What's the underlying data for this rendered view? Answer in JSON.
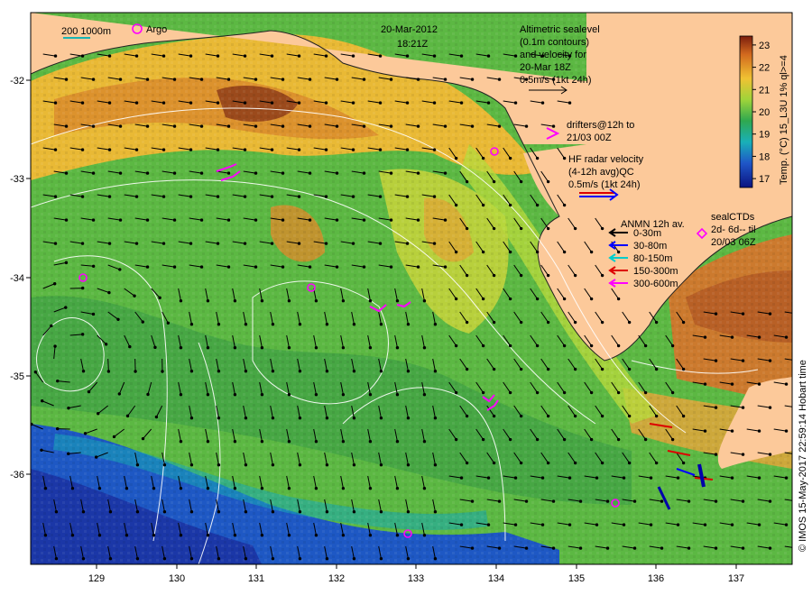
{
  "header": {
    "date": "20-Mar-2012",
    "time": "18:21Z"
  },
  "scale_legend": {
    "depths": "200  1000m",
    "argo": "Argo"
  },
  "altimetry_note": {
    "line1": "Altimetric sealevel",
    "line2": "(0.1m contours)",
    "line3": "and velocity for",
    "line4": "20-Mar 18Z",
    "line5": "0.5m/s (1kt 24h)"
  },
  "drifters_note": {
    "line1": "drifters@12h to",
    "line2": "21/03 00Z"
  },
  "hf_radar_note": {
    "line1": "HF radar velocity",
    "line2": "(4-12h avg)QC",
    "line3": "0.5m/s (1kt 24h)"
  },
  "anmn_legend": {
    "title": "ANMN 12h av.",
    "items": [
      {
        "label": "0-30m",
        "color": "#000000"
      },
      {
        "label": "30-80m",
        "color": "#0000ff"
      },
      {
        "label": "80-150m",
        "color": "#00cccc"
      },
      {
        "label": "150-300m",
        "color": "#dd0000"
      },
      {
        "label": "300-600m",
        "color": "#ff00ff"
      }
    ]
  },
  "seal_ctd_note": {
    "line1": "sealCTDs",
    "line2": "2d- 6d-- til",
    "line3": "20/03 06Z"
  },
  "colorbar": {
    "title": "Temp. (°C) 15_L3U 1% ql>=4",
    "ticks": [
      "23",
      "22",
      "21",
      "20",
      "19",
      "18",
      "17"
    ],
    "min": 16.6,
    "max": 23.4
  },
  "axes": {
    "lon_ticks": [
      "129",
      "130",
      "131",
      "132",
      "133",
      "134",
      "135",
      "136",
      "137"
    ],
    "lat_ticks": [
      "-32",
      "-33",
      "-34",
      "-35",
      "-36"
    ]
  },
  "credit": "© IMOS 15-May-2017 22:59:14 Hobart time",
  "colors": {
    "land": "#fcc99a",
    "warm": "#e8a23a",
    "mid": "#7ccf3b",
    "cool": "#2e8f3c",
    "cold": "#1b3fb8"
  }
}
